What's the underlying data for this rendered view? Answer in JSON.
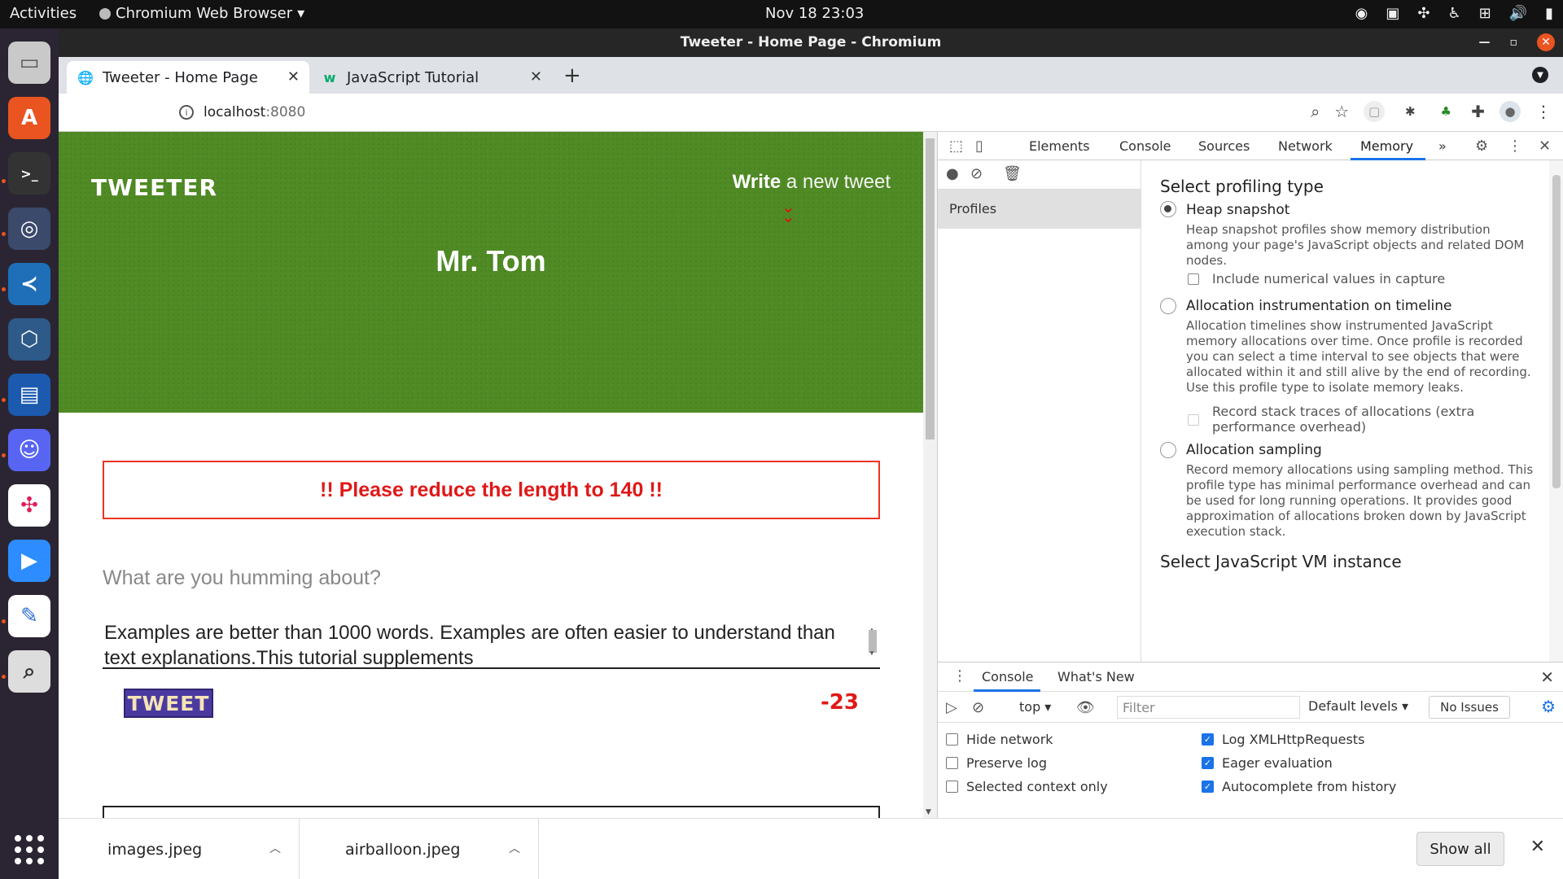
{
  "topbar": {
    "activities": "Activities",
    "app_name": "Chromium Web Browser",
    "app_menu_arrow": "▾",
    "clock": "Nov 18  23:03"
  },
  "window": {
    "title": "Tweeter - Home Page - Chromium"
  },
  "tabs": [
    {
      "label": "Tweeter - Home Page",
      "active": true
    },
    {
      "label": "JavaScript Tutorial",
      "active": false
    }
  ],
  "address": {
    "host": "localhost",
    "port": ":8080"
  },
  "page": {
    "brand": "TWEETER",
    "write_bold": "Write",
    "write_rest": " a new tweet",
    "username": "Mr. Tom",
    "alert": "!! Please reduce the length to 140 !!",
    "prompt": "What are you humming about?",
    "tweet_text": "Examples are better than 1000 words. Examples are often easier to understand than text explanations.This tutorial supplements",
    "tweet_button": "TWEET",
    "counter": "-23"
  },
  "devtools": {
    "tabs": [
      "Elements",
      "Console",
      "Sources",
      "Network",
      "Memory"
    ],
    "active_tab": "Memory",
    "more": "»",
    "sidebar_item": "Profiles",
    "section_title": "Select profiling type",
    "options": [
      {
        "title": "Heap snapshot",
        "checked": true,
        "desc": "Heap snapshot profiles show memory distribution among your page's JavaScript objects and related DOM nodes.",
        "checkbox": "Include numerical values in capture"
      },
      {
        "title": "Allocation instrumentation on timeline",
        "checked": false,
        "desc": "Allocation timelines show instrumented JavaScript memory allocations over time. Once profile is recorded you can select a time interval to see objects that were allocated within it and still alive by the end of recording. Use this profile type to isolate memory leaks.",
        "checkbox": "Record stack traces of allocations (extra performance overhead)"
      },
      {
        "title": "Allocation sampling",
        "checked": false,
        "desc": "Record memory allocations using sampling method. This profile type has minimal performance overhead and can be used for long running operations. It provides good approximation of allocations broken down by JavaScript execution stack."
      }
    ],
    "vm_title": "Select JavaScript VM instance",
    "drawer": {
      "tabs": [
        "Console",
        "What's New"
      ],
      "context": "top",
      "filter_placeholder": "Filter",
      "levels": "Default levels",
      "issues": "No Issues",
      "settings_left": [
        "Hide network",
        "Preserve log",
        "Selected context only"
      ],
      "settings_right": [
        "Log XMLHttpRequests",
        "Eager evaluation",
        "Autocomplete from history"
      ]
    }
  },
  "downloads": {
    "items": [
      "images.jpeg",
      "airballoon.jpeg"
    ],
    "show_all": "Show all"
  }
}
